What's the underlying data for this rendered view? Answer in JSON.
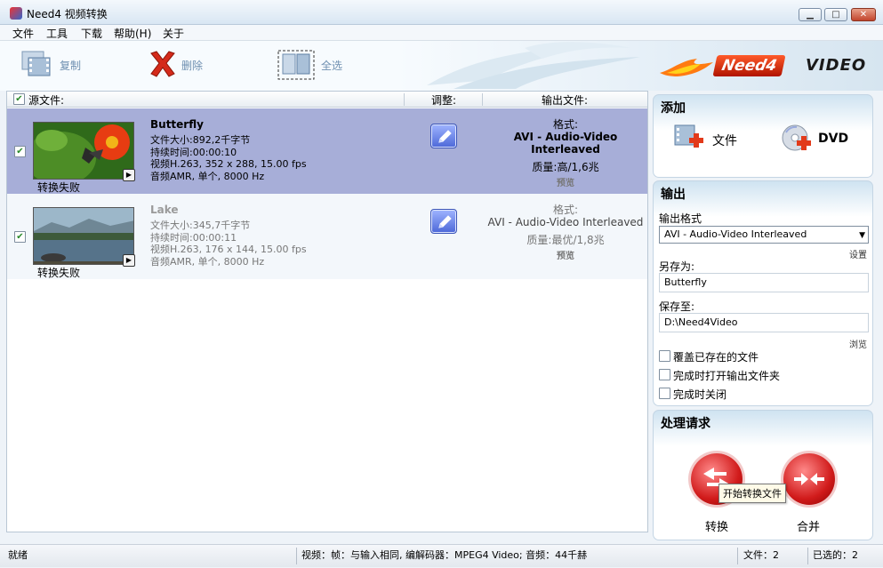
{
  "window": {
    "title": "Need4 视频转换"
  },
  "menu": [
    "文件",
    "工具",
    "下载",
    "帮助(H)",
    "关于"
  ],
  "toolbar": {
    "copy": "复制",
    "delete": "删除",
    "select_all": "全选"
  },
  "brand": {
    "need4": "Need4",
    "video": "VIDEO"
  },
  "list_header": {
    "source": "源文件:",
    "adjust": "调整:",
    "output": "输出文件:"
  },
  "files": [
    {
      "name": "Butterfly",
      "checked": true,
      "size": "文件大小:892,2千字节",
      "duration": "持续时间:00:00:10",
      "video": "视频H.263, 352 x 288, 15.00 fps",
      "audio": "音频AMR, 单个, 8000 Hz",
      "status": "转换失败",
      "format_label": "格式:",
      "format": "AVI - Audio-Video Interleaved",
      "quality": "质量:高/1,6兆",
      "preview": "预览"
    },
    {
      "name": "Lake",
      "checked": true,
      "size": "文件大小:345,7千字节",
      "duration": "持续时间:00:00:11",
      "video": "视频H.263, 176 x 144, 15.00 fps",
      "audio": "音频AMR, 单个, 8000 Hz",
      "status": "转换失败",
      "format_label": "格式:",
      "format": "AVI - Audio-Video Interleaved",
      "quality": "质量:最优/1,8兆",
      "preview": "预览"
    }
  ],
  "add_panel": {
    "title": "添加",
    "file": "文件",
    "dvd": "DVD"
  },
  "output_panel": {
    "title": "输出",
    "format_label": "输出格式",
    "format_value": "AVI - Audio-Video Interleaved",
    "settings": "设置",
    "save_as_label": "另存为:",
    "save_as_value": "Butterfly",
    "save_to_label": "保存至:",
    "save_to_value": "D:\\Need4Video",
    "browse": "浏览",
    "overwrite": "覆盖已存在的文件",
    "open_folder": "完成时打开输出文件夹",
    "close_on_done": "完成时关闭"
  },
  "process_panel": {
    "title": "处理请求",
    "convert": "转换",
    "merge": "合并",
    "tooltip": "开始转换文件"
  },
  "statusbar": {
    "status": "就绪",
    "info": "视频：帧：与输入相同, 编解码器：MPEG4 Video; 音频：44千赫",
    "files": "文件：2",
    "selected": "已选的：2"
  },
  "colors": {
    "selected_row": "#a7aed8",
    "accent_red": "#d11b1b",
    "link": "#6e8fb0"
  }
}
